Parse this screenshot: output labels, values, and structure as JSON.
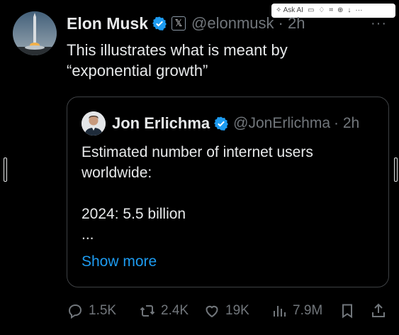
{
  "toolbar": {
    "ask_ai": "Ask AI"
  },
  "post": {
    "author_name": "Elon Musk",
    "author_handle": "@elonmusk",
    "time": "· 2h",
    "more": "···",
    "text": "This illustrates what is meant by “exponential growth”"
  },
  "quote": {
    "author_name": "Jon Erlichma",
    "author_handle": "@JonErlichma",
    "time": "· 2h",
    "body": "Estimated number of internet users worldwide:\n\n2024:  5.5 billion\n...",
    "show_more": "Show more"
  },
  "actions": {
    "replies": "1.5K",
    "reposts": "2.4K",
    "likes": "19K",
    "views": "7.9M"
  },
  "colors": {
    "background": "#000000",
    "text": "#e7e9ea",
    "muted": "#71767b",
    "link": "#1d9bf0",
    "verified": "#1d9bf0"
  }
}
